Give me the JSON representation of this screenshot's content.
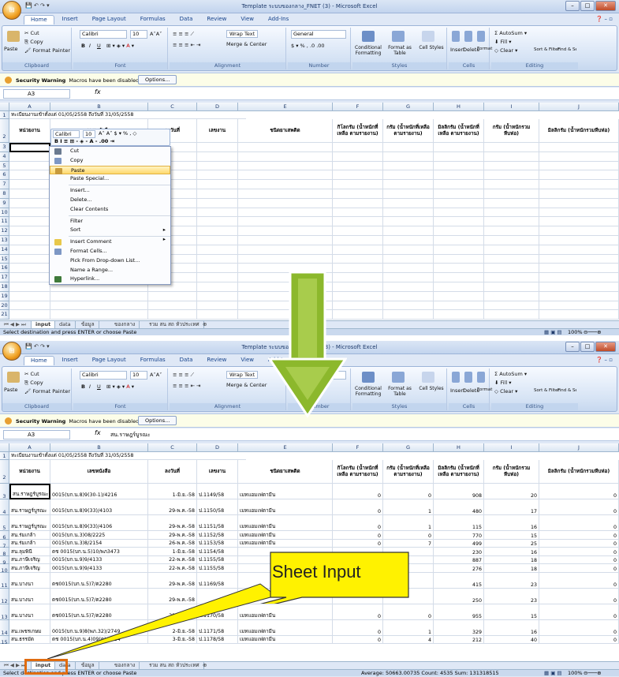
{
  "window": {
    "title": "Template ระบบของกลาง_FNET (3) - Microsoft Excel",
    "win_buttons": [
      "–",
      "□",
      "✕"
    ]
  },
  "ribbon": {
    "tabs": [
      "Home",
      "Insert",
      "Page Layout",
      "Formulas",
      "Data",
      "Review",
      "View",
      "Add-Ins"
    ],
    "clipboard": {
      "paste": "Paste",
      "cut": "Cut",
      "copy": "Copy",
      "format_painter": "Format Painter",
      "label": "Clipboard"
    },
    "font": {
      "name": "Calibri",
      "size": "10",
      "label": "Font",
      "bold": "B",
      "italic": "I",
      "underline": "U"
    },
    "alignment": {
      "wrap": "Wrap Text",
      "merge": "Merge & Center",
      "label": "Alignment"
    },
    "number": {
      "format": "General",
      "label": "Number",
      "percent": "%",
      "comma": ","
    },
    "styles": {
      "conditional": "Conditional Formatting",
      "format_table": "Format as Table",
      "cell_styles": "Cell Styles",
      "label": "Styles"
    },
    "cells": {
      "insert": "Insert",
      "delete": "Delete",
      "format": "Format",
      "label": "Cells"
    },
    "editing": {
      "autosum": "AutoSum",
      "fill": "Fill",
      "clear": "Clear",
      "sort": "Sort & Filter",
      "find": "Find & Select",
      "label": "Editing"
    }
  },
  "security": {
    "title": "Security Warning",
    "message": "Macros have been disabled.",
    "options": "Options..."
  },
  "top": {
    "namebox": "A3",
    "formula": "",
    "row1": "ทะเบียนงานเข้าตั้งแต่  01/05/2558 ถึงวันที่  31/05/2558",
    "status": "Select destination and press ENTER or choose Paste",
    "zoom": "100%"
  },
  "bottom": {
    "namebox": "A3",
    "formula": "สน.ราษฎร์บูรณะ",
    "row1": "ทะเบียนงานเข้าตั้งแต่  01/05/2558 ถึงวันที่  31/05/2558",
    "status": "Select destination and press ENTER or choose Paste",
    "summary": "Average: 50663.00735   Count: 4535   Sum: 131318515",
    "zoom": "100%"
  },
  "columns": [
    "A",
    "B",
    "C",
    "D",
    "E",
    "F",
    "G",
    "H",
    "I",
    "J"
  ],
  "headers": [
    "หน่วยงาน",
    "เลขหนังสือ",
    "ลงวันที่",
    "เลขงาน",
    "ชนิดยาเสพติด",
    "กิโลกรัม (น้ำหนักที่เหลือ ตามรายงาน)",
    "กรัม (น้ำหนักที่เหลือ ตามรายงาน)",
    "มิลลิกรัม (น้ำหนักที่เหลือ ตามรายงาน)",
    "กรัม (น้ำหนักรวมหีบห่อ)",
    "มิลลิกรัม (น้ำหนักรวมหีบห่อ)"
  ],
  "top_rows": [
    "1",
    "2",
    "3",
    "4",
    "5",
    "6",
    "7",
    "8",
    "9",
    "10",
    "11",
    "12",
    "13",
    "14",
    "15",
    "16",
    "17",
    "18",
    "19",
    "20",
    "21"
  ],
  "bottom_rows": [
    {
      "r": "3",
      "a": "สน.ราษฎร์บูรณะ",
      "b": "0015(บก.น.8)9(30-1)/4216",
      "c": "1-มิ.ย.-58",
      "d": "ป.1149/58",
      "e": "เมทแอมเฟตามีน",
      "f": "0",
      "g": "0",
      "h": "908",
      "i": "20",
      "j": "0"
    },
    {
      "r": "4",
      "a": "สน.ราษฎร์บูรณะ",
      "b": "0015(บก.น.8)9(33)/4103",
      "c": "29-พ.ค.-58",
      "d": "ป.1150/58",
      "e": "เมทแอมเฟตามีน",
      "f": "0",
      "g": "1",
      "h": "480",
      "i": "17",
      "j": "0"
    },
    {
      "r": "5",
      "a": "สน.ราษฎร์บูรณะ",
      "b": "0015(บก.น.8)9(33)/4106",
      "c": "29-พ.ค.-58",
      "d": "ป.1151/58",
      "e": "เมทแอมเฟตามีน",
      "f": "0",
      "g": "1",
      "h": "115",
      "i": "16",
      "j": "0"
    },
    {
      "r": "6",
      "a": "สน.ร่มเกล้า",
      "b": "0015(บก.น.3)08/2225",
      "c": "29-พ.ค.-58",
      "d": "ป.1152/58",
      "e": "เมทแอมเฟตามีน",
      "f": "0",
      "g": "0",
      "h": "770",
      "i": "15",
      "j": "0"
    },
    {
      "r": "7",
      "a": "สน.ร่มเกล้า",
      "b": "0015(บก.น.3)8/2154",
      "c": "26-พ.ค.-58",
      "d": "ป.1153/58",
      "e": "เมทแอมเฟตามีน",
      "f": "0",
      "g": "7",
      "h": "499",
      "i": "25",
      "j": "0"
    },
    {
      "r": "8",
      "a": "สน.ลุมพินี",
      "b": "ตช  0015(บก.น.5)10/พภ3473",
      "c": "1-มิ.ย.-58",
      "d": "ป.1154/58",
      "e": "",
      "f": "",
      "g": "",
      "h": "230",
      "i": "16",
      "j": "0"
    },
    {
      "r": "9",
      "a": "สน.ภาษีเจริญ",
      "b": "0015(บก.น.9)9/4133",
      "c": "22-พ.ค.-58",
      "d": "ป.1155/58",
      "e": "",
      "f": "",
      "g": "",
      "h": "887",
      "i": "18",
      "j": "0"
    },
    {
      "r": "10",
      "a": "สน.ภาษีเจริญ",
      "b": "0015(บก.น.9)9/4133",
      "c": "22-พ.ค.-58",
      "d": "ป.1155/58",
      "e": "",
      "f": "",
      "g": "",
      "h": "276",
      "i": "18",
      "j": "0"
    },
    {
      "r": "11",
      "a": "สน.บางนา",
      "b": "ตช0015(บก.น.5)7/ต2280",
      "c": "29-พ.ค.-58",
      "d": "ป.1169/58",
      "e": "",
      "f": "",
      "g": "",
      "h": "415",
      "i": "23",
      "j": "0"
    },
    {
      "r": "12",
      "a": "สน.บางนา",
      "b": "ตช0015(บก.น.5)7/ต2280",
      "c": "29-พ.ค.-58",
      "d": "",
      "e": "",
      "f": "",
      "g": "",
      "h": "250",
      "i": "23",
      "j": "0"
    },
    {
      "r": "13",
      "a": "สน.บางนา",
      "b": "ตช0015(บก.น.5)7/ต2280",
      "c": "29-พ.ค.-58",
      "d": "ป.1170/58",
      "e": "เมทแอมเฟตามีน",
      "f": "0",
      "g": "0",
      "h": "955",
      "i": "15",
      "j": "0"
    },
    {
      "r": "14",
      "a": "สน.เพชรเกษม",
      "b": "0015(บก.น.9)8(พภ.32)/2749",
      "c": "2-มิ.ย.-58",
      "d": "ป.1171/58",
      "e": "เมทแอมเฟตามีน",
      "f": "0",
      "g": "1",
      "h": "329",
      "i": "16",
      "j": "0"
    },
    {
      "r": "15",
      "a": "สน.ธรรมัต",
      "b": "ตช  0015(บก.น.4)09(ต)/2624",
      "c": "3-มิ.ย.-58",
      "d": "ป.1178/58",
      "e": "เมทแอมเฟตามีน",
      "f": "0",
      "g": "4",
      "h": "212",
      "i": "40",
      "j": "0"
    }
  ],
  "context_menu": [
    {
      "label": "Cut",
      "icon": "scissors-icon",
      "color": "#6a7a90"
    },
    {
      "label": "Copy",
      "icon": "copy-icon",
      "color": "#7d97c4"
    },
    {
      "label": "Paste",
      "icon": "paste-icon",
      "color": "#c79a3c",
      "highlight": true
    },
    {
      "label": "Paste Special...",
      "icon": "",
      "color": ""
    },
    {
      "sep": true
    },
    {
      "label": "Insert...",
      "icon": "",
      "color": ""
    },
    {
      "label": "Delete...",
      "icon": "",
      "color": ""
    },
    {
      "label": "Clear Contents",
      "icon": "",
      "color": ""
    },
    {
      "sep": true
    },
    {
      "label": "Filter",
      "icon": "",
      "color": "",
      "submenu": true
    },
    {
      "label": "Sort",
      "icon": "",
      "color": "",
      "submenu": true
    },
    {
      "sep": true
    },
    {
      "label": "Insert Comment",
      "icon": "comment-icon",
      "color": "#e8c84a"
    },
    {
      "label": "Format Cells...",
      "icon": "format-cells-icon",
      "color": "#7d97c4"
    },
    {
      "label": "Pick From Drop-down List...",
      "icon": "",
      "color": ""
    },
    {
      "label": "Name a Range...",
      "icon": "",
      "color": ""
    },
    {
      "label": "Hyperlink...",
      "icon": "hyperlink-icon",
      "color": "#3f7a3a"
    }
  ],
  "mini_toolbar": {
    "font": "Calibri",
    "size": "10",
    "line2": "B  I  ≡  ⊞ - ◈ - A -  .00  ⇥"
  },
  "sheet_tabs": [
    "input",
    "data",
    "ข้อมูล",
    "ของกลาง",
    "รวม สน สถ หัวประเทศ"
  ],
  "annotation": {
    "callout": "Sheet Input",
    "arrow_color": "#8cb82c",
    "callout_color": "#fff200",
    "box_color": "#e06c10"
  }
}
